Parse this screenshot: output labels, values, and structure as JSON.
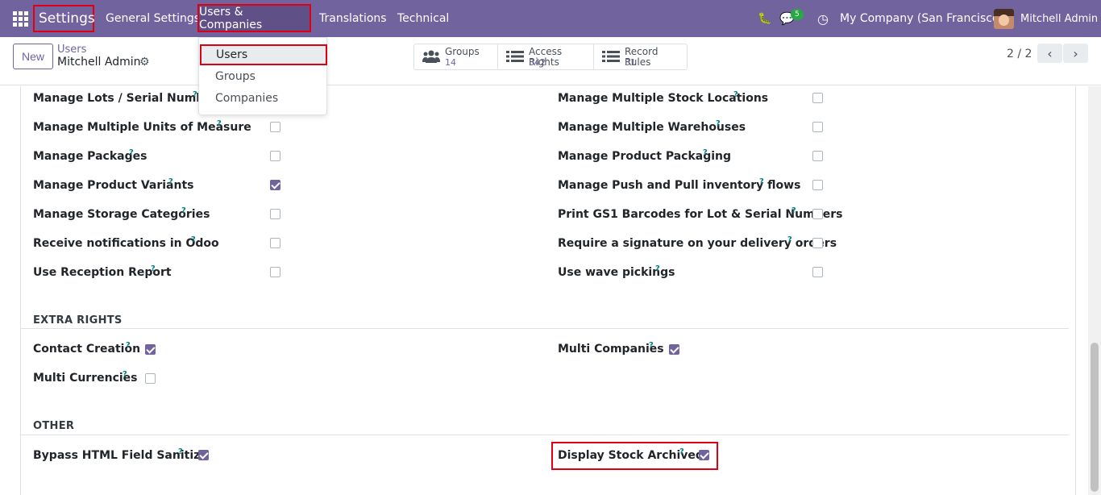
{
  "navbar": {
    "brand": "Settings",
    "menus": [
      "General Settings",
      "Users & Companies",
      "Translations",
      "Technical"
    ],
    "chat_count": "5",
    "company": "My Company (San Francisco)",
    "user": "Mitchell Admin",
    "accent_color": "#71639e"
  },
  "dropdown": {
    "items": [
      "Users",
      "Groups",
      "Companies"
    ]
  },
  "control": {
    "new_label": "New",
    "breadcrumb_parent": "Users",
    "breadcrumb_current": "Mitchell Admin",
    "smart_buttons": [
      {
        "label": "Groups",
        "value": "14",
        "icon": "users-icon"
      },
      {
        "label": "Access Rights",
        "value": "342",
        "icon": "list-icon"
      },
      {
        "label": "Record Rules",
        "value": "31",
        "icon": "list-icon"
      }
    ],
    "pager": "2 / 2"
  },
  "help_mark": "?",
  "fields_left": [
    {
      "label": "Manage Lots / Serial Numbers",
      "checked": false
    },
    {
      "label": "Manage Multiple Units of Measure",
      "checked": false
    },
    {
      "label": "Manage Packages",
      "checked": false
    },
    {
      "label": "Manage Product Variants",
      "checked": true
    },
    {
      "label": "Manage Storage Categories",
      "checked": false
    },
    {
      "label": "Receive notifications in Odoo",
      "checked": false
    },
    {
      "label": "Use Reception Report",
      "checked": false
    }
  ],
  "fields_right": [
    {
      "label": "Manage Multiple Stock Locations",
      "checked": false
    },
    {
      "label": "Manage Multiple Warehouses",
      "checked": false
    },
    {
      "label": "Manage Product Packaging",
      "checked": false
    },
    {
      "label": "Manage Push and Pull inventory flows",
      "checked": false
    },
    {
      "label": "Print GS1 Barcodes for Lot & Serial Numbers",
      "checked": false
    },
    {
      "label": "Require a signature on your delivery orders",
      "checked": false
    },
    {
      "label": "Use wave pickings",
      "checked": false
    }
  ],
  "extra_rights": {
    "title": "EXTRA RIGHTS",
    "contact_creation": {
      "label": "Contact Creation",
      "checked": true
    },
    "multi_companies": {
      "label": "Multi Companies",
      "checked": true
    },
    "multi_currencies": {
      "label": "Multi Currencies",
      "checked": false
    }
  },
  "other": {
    "title": "OTHER",
    "bypass_html": {
      "label": "Bypass HTML Field Sanitize",
      "checked": true
    },
    "display_stock_archived": {
      "label": "Display Stock Archived",
      "checked": true
    }
  }
}
